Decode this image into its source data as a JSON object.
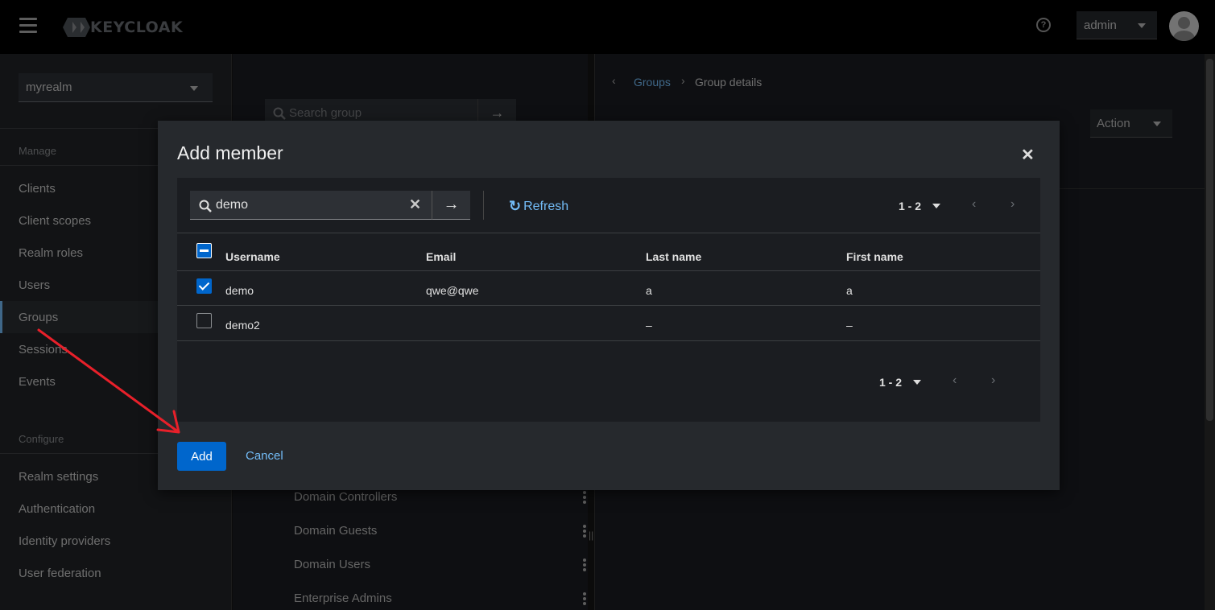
{
  "header": {
    "logo_text": "KEYCLOAK",
    "user_menu_label": "admin"
  },
  "sidebar": {
    "realm": "myrealm",
    "manage_label": "Manage",
    "configure_label": "Configure",
    "manage_items": [
      "Clients",
      "Client scopes",
      "Realm roles",
      "Users",
      "Groups",
      "Sessions",
      "Events"
    ],
    "configure_items": [
      "Realm settings",
      "Authentication",
      "Identity providers",
      "User federation"
    ],
    "active_item": "Groups"
  },
  "groups_panel": {
    "search_placeholder": "Search group",
    "groups": [
      "Domain Controllers",
      "Domain Guests",
      "Domain Users",
      "Enterprise Admins"
    ]
  },
  "detail_panel": {
    "breadcrumb_link": "Groups",
    "breadcrumb_current": "Group details",
    "action_label": "Action"
  },
  "modal": {
    "title": "Add member",
    "search_value": "demo",
    "refresh_label": "Refresh",
    "pagination_label": "1 - 2",
    "columns": [
      "Username",
      "Email",
      "Last name",
      "First name"
    ],
    "rows": [
      {
        "username": "demo",
        "email": "qwe@qwe",
        "last_name": "a",
        "first_name": "a",
        "checked": true
      },
      {
        "username": "demo2",
        "email": "",
        "last_name": "–",
        "first_name": "–",
        "checked": false
      }
    ],
    "add_label": "Add",
    "cancel_label": "Cancel"
  },
  "colors": {
    "primary": "#0066cc",
    "link": "#73bcf7",
    "annotation_arrow": "#e8202a"
  }
}
